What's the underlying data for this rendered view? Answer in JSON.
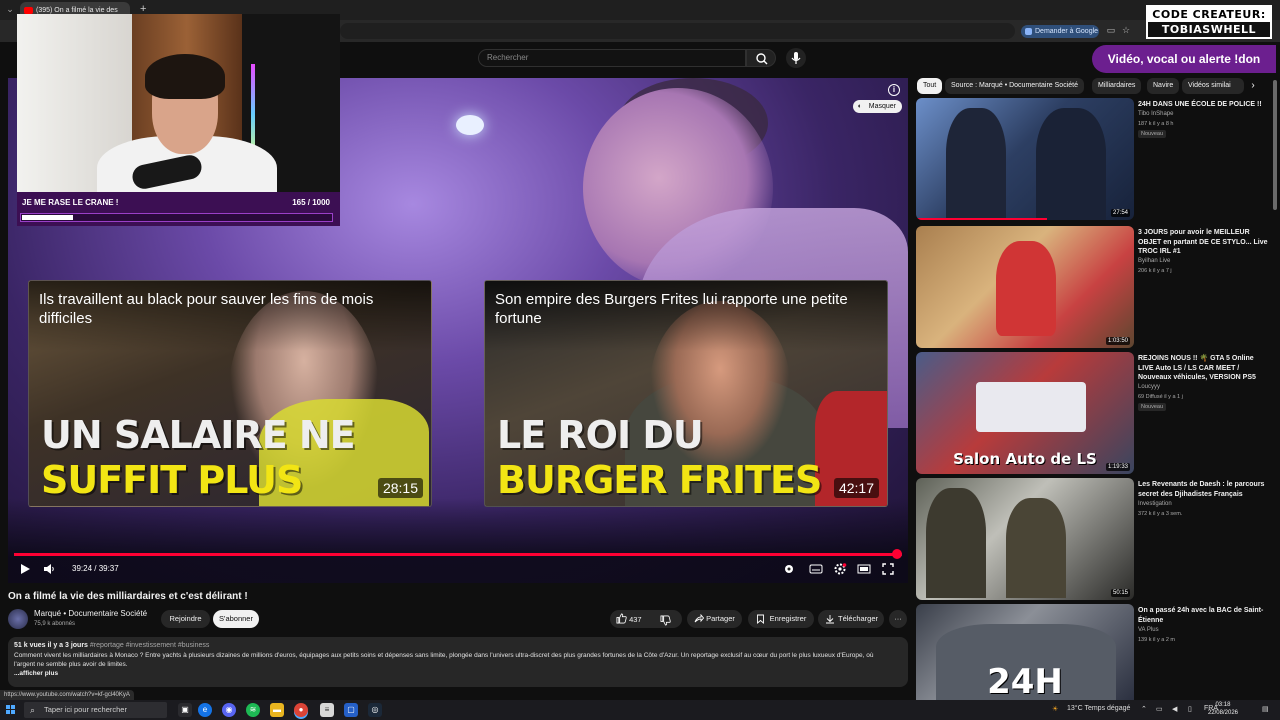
{
  "browser": {
    "tab_title": "(395) On a filmé la vie des",
    "new_tab_symbol": "+",
    "google_pill": "Demander à Google"
  },
  "youtube": {
    "search_placeholder": "Rechercher"
  },
  "overlays": {
    "creator_code_label": "CODE CREATEUR:",
    "creator_code_value": "TOBIASWHELL",
    "donation_button": "Vidéo, vocal ou alerte !don",
    "goal_title": "JE ME RASE LE CRANE !",
    "goal_count": "165 / 1000",
    "goal_progress": 0.165
  },
  "player": {
    "hide_label": "Masquer",
    "end_cards": [
      {
        "title": "Ils travaillent au black pour sauver les fins de mois difficiles",
        "thumb_line1": "UN SALAIRE NE",
        "thumb_line2": "SUFFIT PLUS",
        "duration": "28:15"
      },
      {
        "title": "Son empire des Burgers Frites lui rapporte une petite fortune",
        "thumb_line1": "LE ROI DU",
        "thumb_line2": "BURGER FRITES",
        "duration": "42:17"
      }
    ],
    "time_display": "39:24 / 39:37",
    "progress": 0.9945
  },
  "video": {
    "title": "On a filmé la vie des milliardaires et c'est délirant !",
    "channel_name": "Marqué",
    "channel_category": "Documentaire Société",
    "subscribers": "75,9 k abonnés",
    "join_label": "Rejoindre",
    "subscribe_label": "S'abonner",
    "likes": "437",
    "share_label": "Partager",
    "save_label": "Enregistrer",
    "download_label": "Télécharger",
    "views": "51 k vues",
    "age": "il y a 3 jours",
    "hashtags": "#reportage #investissement #business",
    "description": "Comment vivent les milliardaires à Monaco ? Entre yachts à plusieurs dizaines de millions d'euros, équipages aux petits soins et dépenses sans limite, plongée dans l'univers ultra-discret des plus grandes fortunes de la Côte d'Azur. Un reportage exclusif au cœur du port le plus luxueux d'Europe, où l'argent ne semble plus avoir de limites.",
    "show_more": "...afficher plus",
    "status_url": "https://www.youtube.com/watch?v=kf-gcl40KyA"
  },
  "sidebar": {
    "chips": [
      "Tout",
      "Source : Marqué",
      "Documentaire Société",
      "Milliardaires",
      "Navire",
      "Vidéos similai"
    ],
    "recommendations": [
      {
        "title": "24H DANS UNE ÉCOLE DE POLICE !!",
        "channel": "Tibo InShape",
        "meta": "187 k  il y a 8 h",
        "badge": "Nouveau",
        "duration": "27:54"
      },
      {
        "title": "3 JOURS pour avoir le MEILLEUR OBJET en partant DE CE STYLO... Live TROC IRL #1",
        "channel": "Byilhan Live",
        "meta": "206 k  il y a 7 j",
        "badge": "",
        "duration": "1:03:50"
      },
      {
        "title": "REJOINS NOUS !! 🌴 GTA 5 Online LIVE Auto LS / LS CAR MEET / Nouveaux véhicules, VERSION PS5",
        "channel": "Loucyyy",
        "meta": "69  Diffusé il y a 1 j",
        "badge": "Nouveau",
        "duration": "1:19:33",
        "thumb_text": "Salon Auto de LS"
      },
      {
        "title": "Les Revenants de Daesh : le parcours secret des Djihadistes Français",
        "channel": "Investigation",
        "meta": "372 k  il y a 3 sem.",
        "badge": "",
        "duration": "50:15"
      },
      {
        "title": "On a passé 24h avec la BAC de Saint-Étienne",
        "channel": "VA Plus",
        "meta": "139 k  il y a 2 m",
        "badge": "",
        "duration": "",
        "thumb_text": "24H"
      }
    ]
  },
  "taskbar": {
    "search_placeholder": "Taper ici pour rechercher",
    "weather": "13°C  Temps dégagé",
    "language": "FRA",
    "time": "03:18",
    "date": "22/08/2026"
  }
}
